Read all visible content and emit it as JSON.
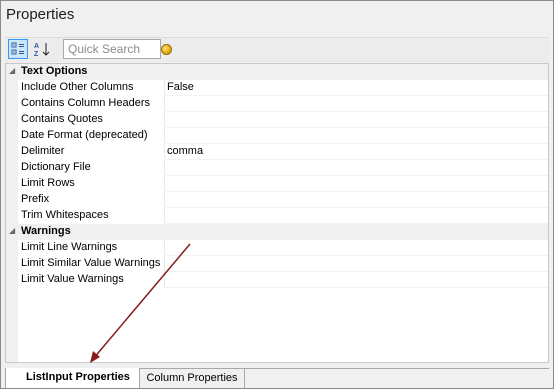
{
  "panel": {
    "title": "Properties"
  },
  "toolbar": {
    "categorized_icon": "categorized-view-icon",
    "alphabetical_icon": "alphabetical-sort-icon",
    "search_placeholder": "Quick Search",
    "extra_icon": "coin-icon"
  },
  "grid": {
    "categories": [
      {
        "label": "Text Options",
        "properties": [
          {
            "name": "Include Other Columns",
            "value": "False"
          },
          {
            "name": "Contains Column Headers",
            "value": ""
          },
          {
            "name": "Contains Quotes",
            "value": ""
          },
          {
            "name": "Date Format (deprecated)",
            "value": ""
          },
          {
            "name": "Delimiter",
            "value": "comma"
          },
          {
            "name": "Dictionary File",
            "value": ""
          },
          {
            "name": "Limit Rows",
            "value": ""
          },
          {
            "name": "Prefix",
            "value": ""
          },
          {
            "name": "Trim Whitespaces",
            "value": ""
          }
        ]
      },
      {
        "label": "Warnings",
        "properties": [
          {
            "name": "Limit Line Warnings",
            "value": ""
          },
          {
            "name": "Limit Similar Value Warnings",
            "value": ""
          },
          {
            "name": "Limit Value Warnings",
            "value": ""
          }
        ]
      }
    ]
  },
  "tabs": [
    {
      "label": "ListInput Properties",
      "active": true
    },
    {
      "label": "Column Properties",
      "active": false
    }
  ],
  "annotation": {
    "arrow_color": "#8b1a1a"
  },
  "colors": {
    "selected_button": "#cde6f7",
    "selected_border": "#3399ff"
  }
}
